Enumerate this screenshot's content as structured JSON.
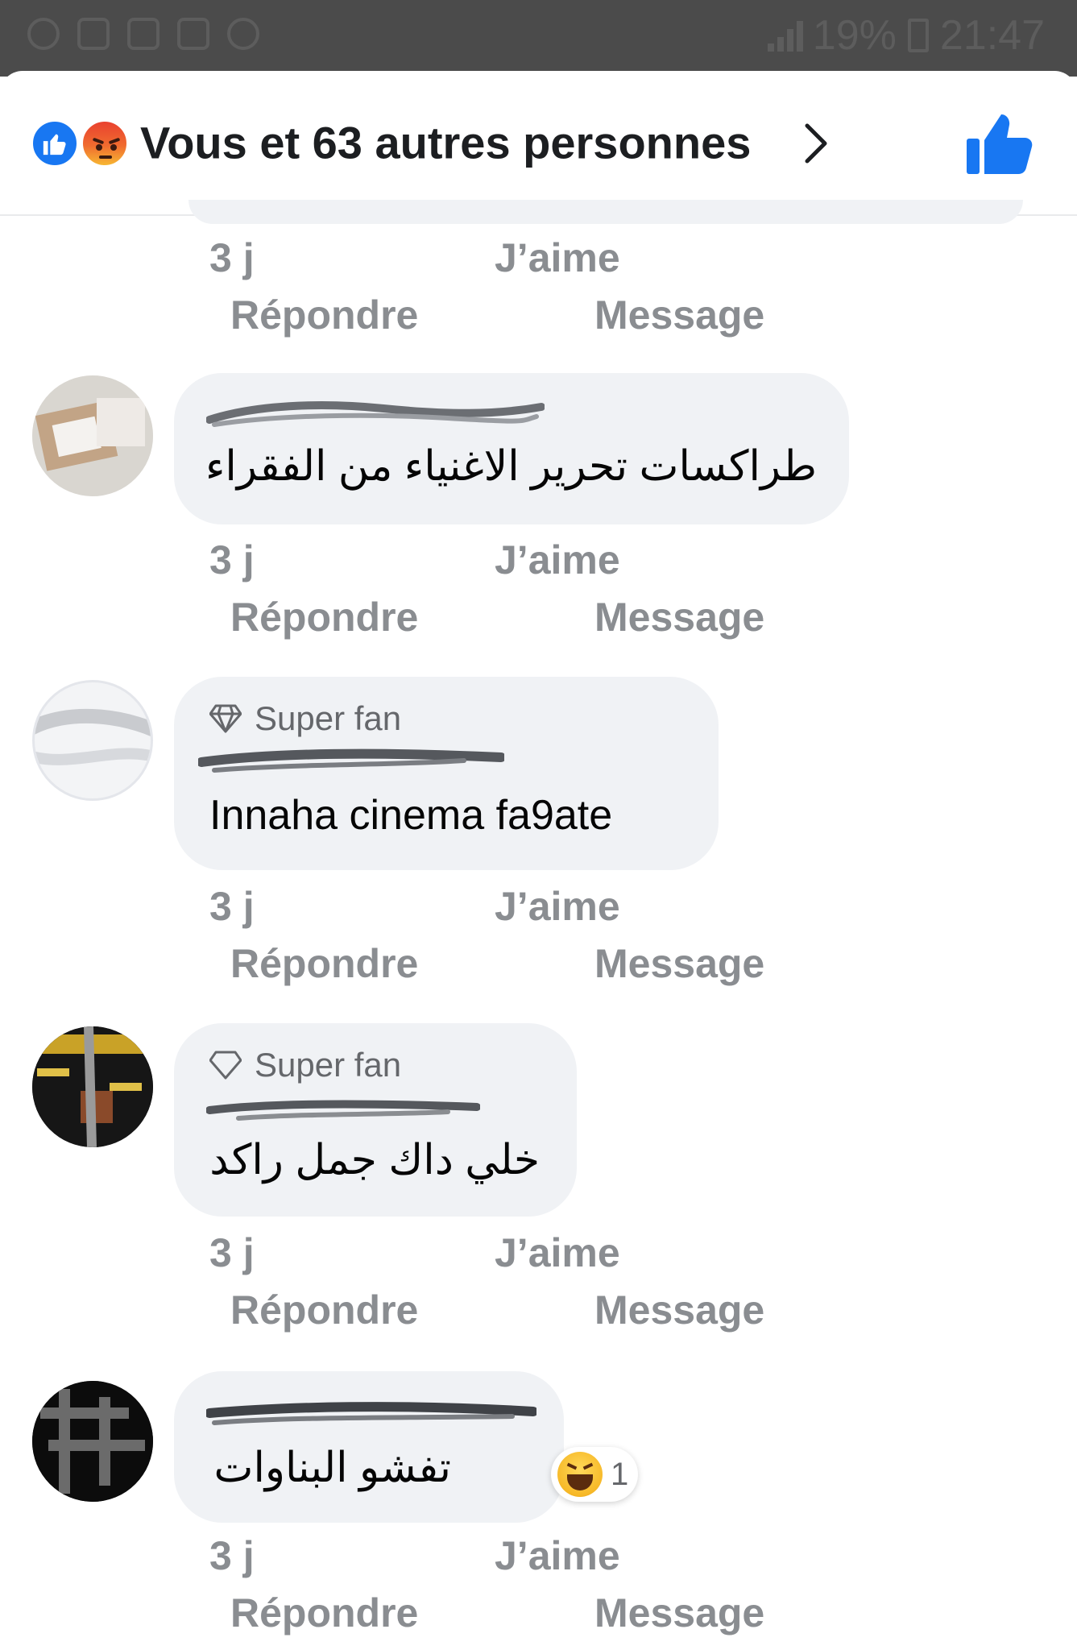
{
  "status_bar": {
    "battery": "19%",
    "time": "21:47"
  },
  "header": {
    "title": "Vous et 63 autres personnes",
    "reaction_icons": [
      "like-icon",
      "angry-icon"
    ],
    "like_button_icon": "thumbs-up-icon"
  },
  "actions": {
    "time": "3 j",
    "like": "J’aime",
    "reply": "Répondre",
    "message": "Message"
  },
  "comments": [
    {
      "badge": "",
      "text": "طراكسات تحرير الاغنياء من الفقراء"
    },
    {
      "badge": "Super fan",
      "text": "Innaha cinema fa9ate"
    },
    {
      "badge": "Super fan",
      "text": "خلي داك جمل راكد"
    },
    {
      "badge": "",
      "text": "تفشو البناوات",
      "reaction_count": "1",
      "reaction_icon": "haha-icon"
    }
  ],
  "colors": {
    "brand_blue": "#1877f2",
    "bubble_bg": "#f0f2f5",
    "meta_text": "#8a8d91"
  }
}
